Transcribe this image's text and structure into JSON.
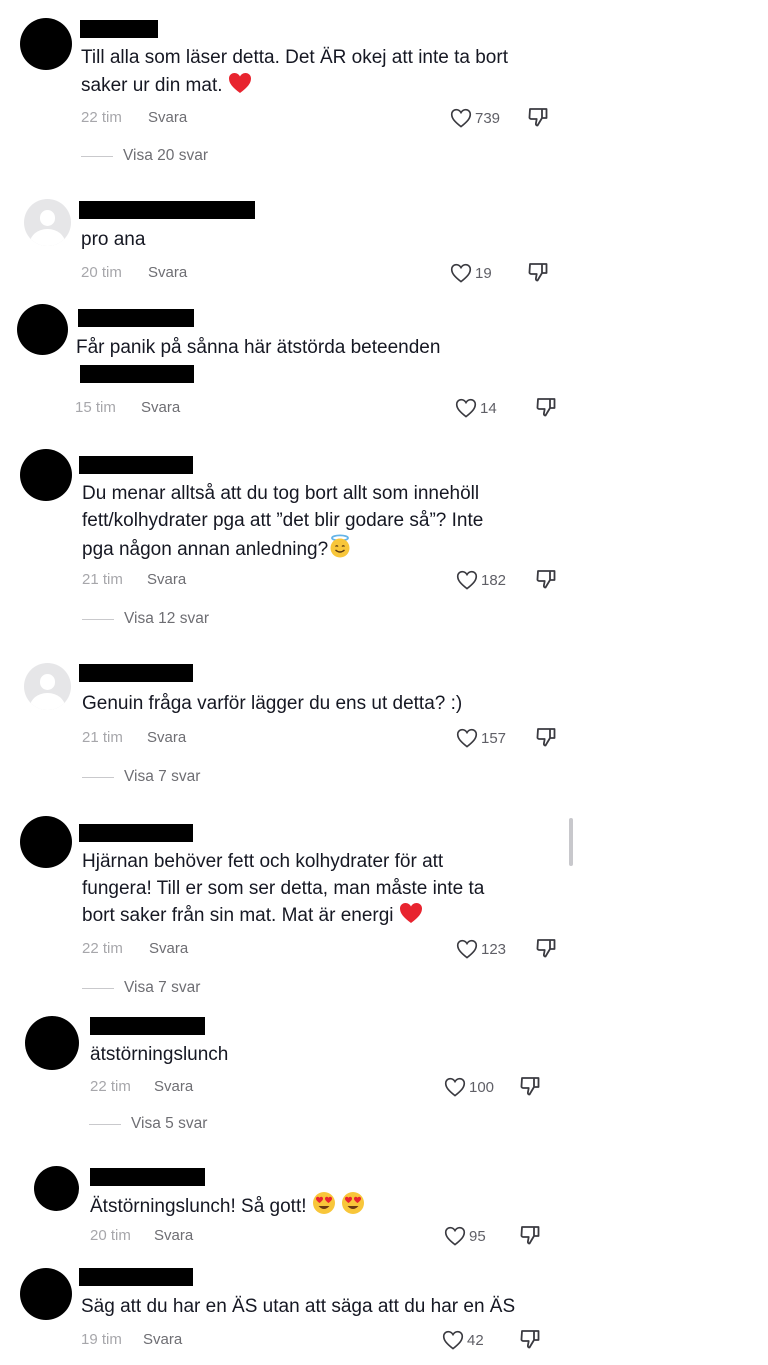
{
  "comments": [
    {
      "lines": [
        "Till alla som läser detta. Det ÄR okej att inte ta bort",
        "saker ur din mat."
      ],
      "emoji": "heart",
      "time": "22 tim",
      "reply": "Svara",
      "likes": "739",
      "view_replies": "Visa 20 svar",
      "avatar": "black"
    },
    {
      "lines": [
        "pro ana"
      ],
      "time": "20 tim",
      "reply": "Svara",
      "likes": "19",
      "avatar": "default"
    },
    {
      "lines": [
        "Får panik på sånna här ätstörda beteenden"
      ],
      "time": "15 tim",
      "reply": "Svara",
      "likes": "14",
      "avatar": "black"
    },
    {
      "lines": [
        "Du menar alltså att du tog bort allt som innehöll",
        "fett/kolhydrater pga att ”det blir godare så”? Inte",
        "pga någon annan anledning?"
      ],
      "emoji": "halo",
      "time": "21 tim",
      "reply": "Svara",
      "likes": "182",
      "view_replies": "Visa 12 svar",
      "avatar": "black"
    },
    {
      "lines": [
        "Genuin fråga varför lägger du ens ut detta? :)"
      ],
      "time": "21 tim",
      "reply": "Svara",
      "likes": "157",
      "view_replies": "Visa 7 svar",
      "avatar": "default"
    },
    {
      "lines": [
        "Hjärnan behöver fett och kolhydrater för att",
        "fungera! Till er som ser detta, man måste inte ta",
        "bort saker från sin mat. Mat är energi"
      ],
      "emoji": "heart",
      "time": "22 tim",
      "reply": "Svara",
      "likes": "123",
      "view_replies": "Visa 7 svar",
      "avatar": "black"
    },
    {
      "lines": [
        "ätstörningslunch"
      ],
      "time": "22 tim",
      "reply": "Svara",
      "likes": "100",
      "view_replies": "Visa 5 svar",
      "avatar": "black"
    },
    {
      "lines": [
        "Ätstörningslunch! Så gott!"
      ],
      "emoji": "hearteyes2",
      "time": "20 tim",
      "reply": "Svara",
      "likes": "95",
      "avatar": "black"
    },
    {
      "lines": [
        "Säg att du har en ÄS utan att säga att du har en ÄS"
      ],
      "time": "19 tim",
      "reply": "Svara",
      "likes": "42",
      "avatar": "black"
    }
  ],
  "colors": {
    "text": "#161823",
    "muted": "#a7a7ab",
    "reply": "#6e6e73",
    "redaction": "#000000"
  }
}
